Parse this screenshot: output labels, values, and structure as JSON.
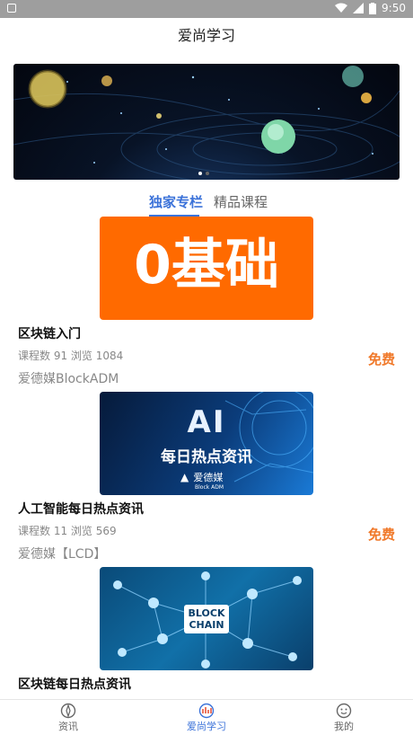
{
  "status": {
    "time": "9:50"
  },
  "header": {
    "title": "爱尚学习"
  },
  "tabs": [
    {
      "label": "独家专栏"
    },
    {
      "label": "精品课程"
    }
  ],
  "courses": [
    {
      "cover_text": "0基础",
      "title": "区块链入门",
      "meta": "课程数 91  浏览 1084",
      "author": "爱德媒BlockADM",
      "price": "免费"
    },
    {
      "cover_text_main": "AI",
      "cover_text_sub": "每日热点资讯",
      "cover_brand": "爱德媒",
      "cover_brand_sub": "Block ADM",
      "title": "人工智能每日热点资讯",
      "meta": "课程数 11  浏览 569",
      "author": "爱德媒【LCD】",
      "price": "免费"
    },
    {
      "cover_text_main": "BLOCK",
      "cover_text_sub": "CHAIN",
      "title": "区块链每日热点资讯"
    }
  ],
  "bottom_nav": [
    {
      "label": "资讯"
    },
    {
      "label": "爱尚学习"
    },
    {
      "label": "我的"
    }
  ],
  "colors": {
    "accent": "#3b72d9",
    "price": "#f0792a",
    "cover_orange": "#ff6a00"
  }
}
